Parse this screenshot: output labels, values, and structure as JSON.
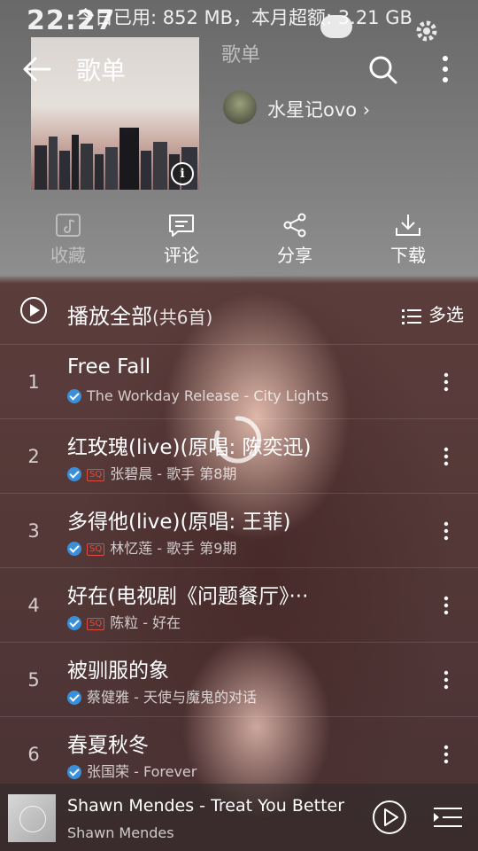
{
  "status_bar": {
    "time": "22:27",
    "data_usage": "今日已用: 852 MB，本月超额: 3.21 GB"
  },
  "app_bar": {
    "title": "歌单"
  },
  "playlist": {
    "name": "歌单",
    "creator": "水星记ovo ›"
  },
  "actions": [
    {
      "label": "收藏",
      "icon": "collect-icon",
      "enabled": false
    },
    {
      "label": "评论",
      "icon": "comment-icon",
      "enabled": true
    },
    {
      "label": "分享",
      "icon": "share-icon",
      "enabled": true
    },
    {
      "label": "下载",
      "icon": "download-icon",
      "enabled": true
    }
  ],
  "play_all": {
    "label": "播放全部",
    "count": "(共6首)",
    "multi_select": "多选"
  },
  "songs": [
    {
      "num": "1",
      "title": "Free Fall",
      "sq": "",
      "subtitle": "The Workday Release - City Lights"
    },
    {
      "num": "2",
      "title": "红玫瑰(live)(原唱: 陈奕迅)",
      "sq": "SQ",
      "subtitle": "张碧晨 - 歌手 第8期"
    },
    {
      "num": "3",
      "title": "多得他(live)(原唱: 王菲)",
      "sq": "SQ",
      "subtitle": "林忆莲 - 歌手 第9期"
    },
    {
      "num": "4",
      "title": "好在(电视剧《问题餐厅》···",
      "sq": "SQ",
      "subtitle": "陈粒 - 好在"
    },
    {
      "num": "5",
      "title": "被驯服的象",
      "sq": "",
      "subtitle": "蔡健雅 - 天使与魔鬼的对话"
    },
    {
      "num": "6",
      "title": "春夏秋冬",
      "sq": "",
      "subtitle": "张国荣 - Forever"
    }
  ],
  "player": {
    "track": "Shawn Mendes - Treat You Better",
    "artist": "Shawn Mendes"
  },
  "colors": {
    "check_blue": "#3b8fd8",
    "sq_red": "#e04a3f"
  }
}
